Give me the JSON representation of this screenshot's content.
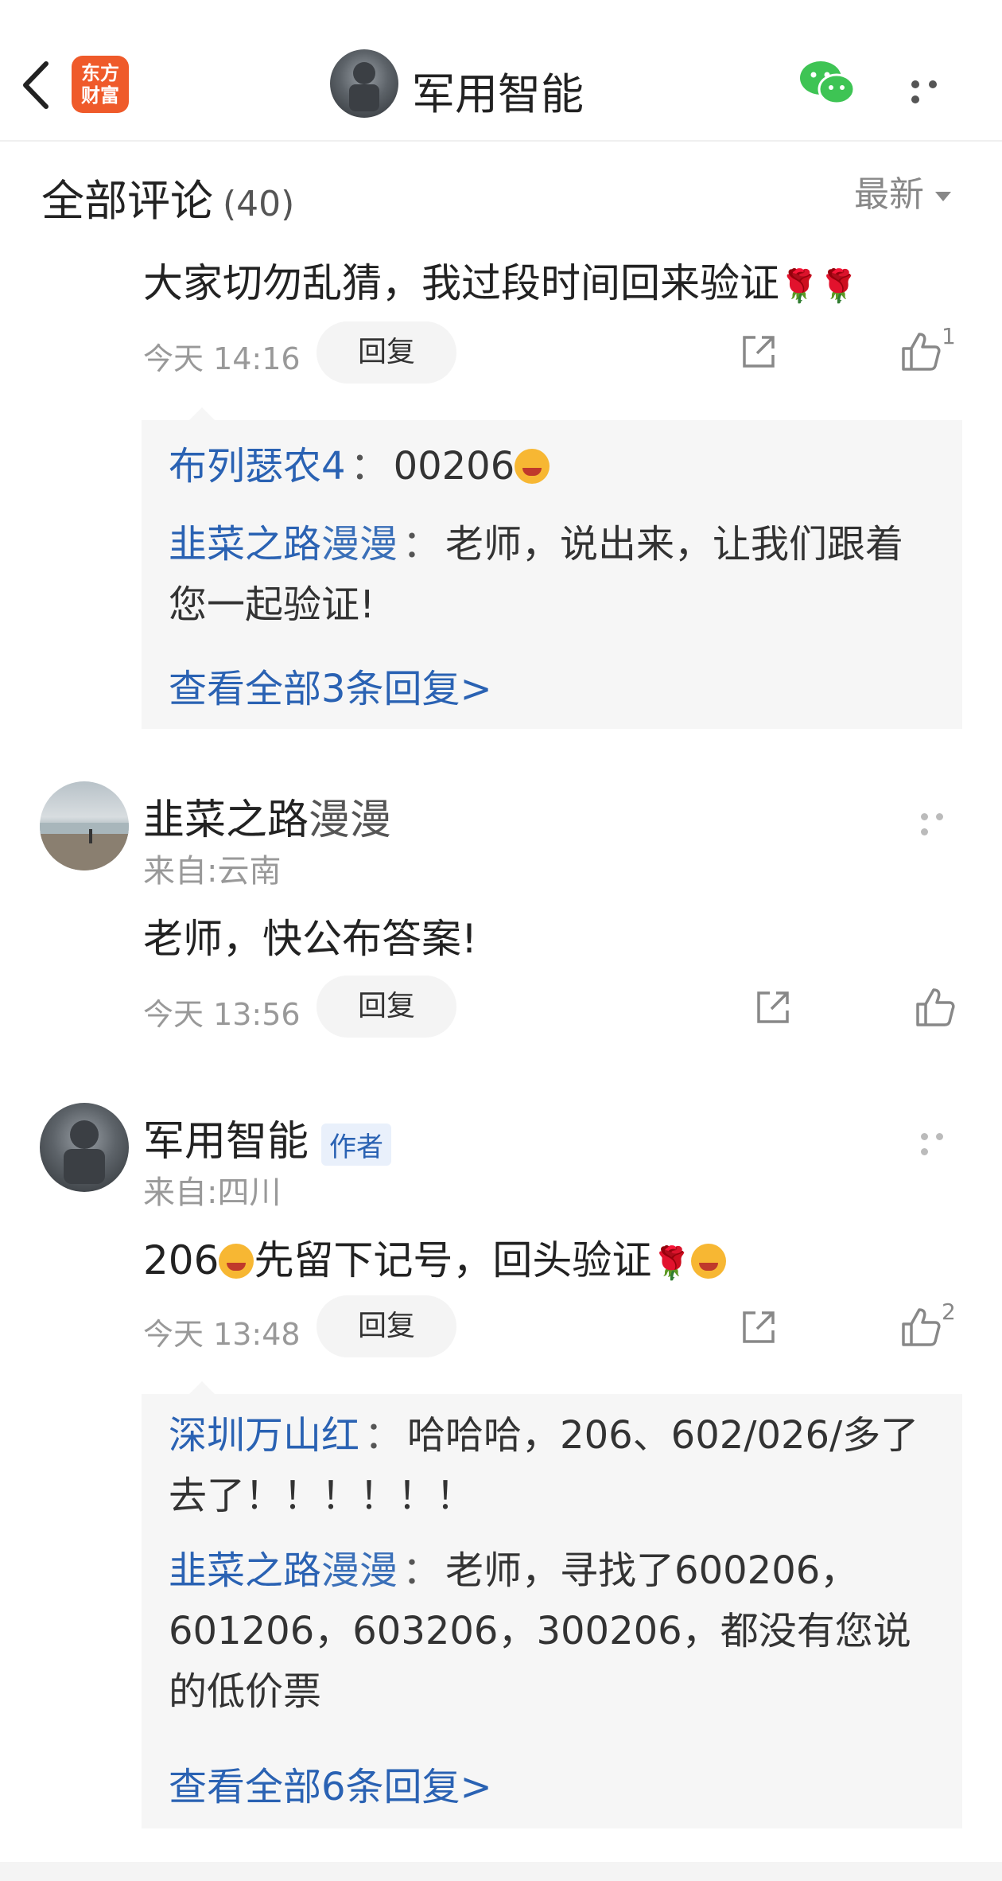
{
  "header": {
    "logo_text": "东方\n财富",
    "title": "军用智能"
  },
  "section": {
    "title": "全部评论",
    "count": "(40)",
    "sort": "最新"
  },
  "comment1": {
    "text": "大家切勿乱猜，我过段时间回来验证",
    "time": "今天 14:16",
    "reply_label": "回复",
    "like_count": "1",
    "replies": [
      {
        "name": "布列瑟农4",
        "text": "00206"
      },
      {
        "name_a": "韭菜之路",
        "name_b": "漫漫",
        "text": "老师，说出来，让我们跟着您一起验证!"
      }
    ],
    "more": "查看全部3条回复>"
  },
  "comment2": {
    "name_a": "韭菜之路",
    "name_b": "漫漫",
    "from": "来自:云南",
    "text": "老师，快公布答案!",
    "time": "今天 13:56",
    "reply_label": "回复"
  },
  "comment3": {
    "name": "军用智能",
    "badge": "作者",
    "from": "来自:四川",
    "text_a": "206",
    "text_b": "先留下记号，回头验证",
    "time": "今天 13:48",
    "reply_label": "回复",
    "like_count": "2",
    "replies": [
      {
        "name": "深圳万山红",
        "text": "哈哈哈，206、602/026/多了去了！！！！！！"
      },
      {
        "name_a": "韭菜之路",
        "name_b": "漫漫",
        "text": "老师，寻找了600206，601206，603206，300206，都没有您说的低价票"
      }
    ],
    "more": "查看全部6条回复>"
  },
  "icons": {
    "back": "chevron-left-icon",
    "wechat": "wechat-icon",
    "share": "share-icon",
    "like": "thumbs-up-icon"
  }
}
